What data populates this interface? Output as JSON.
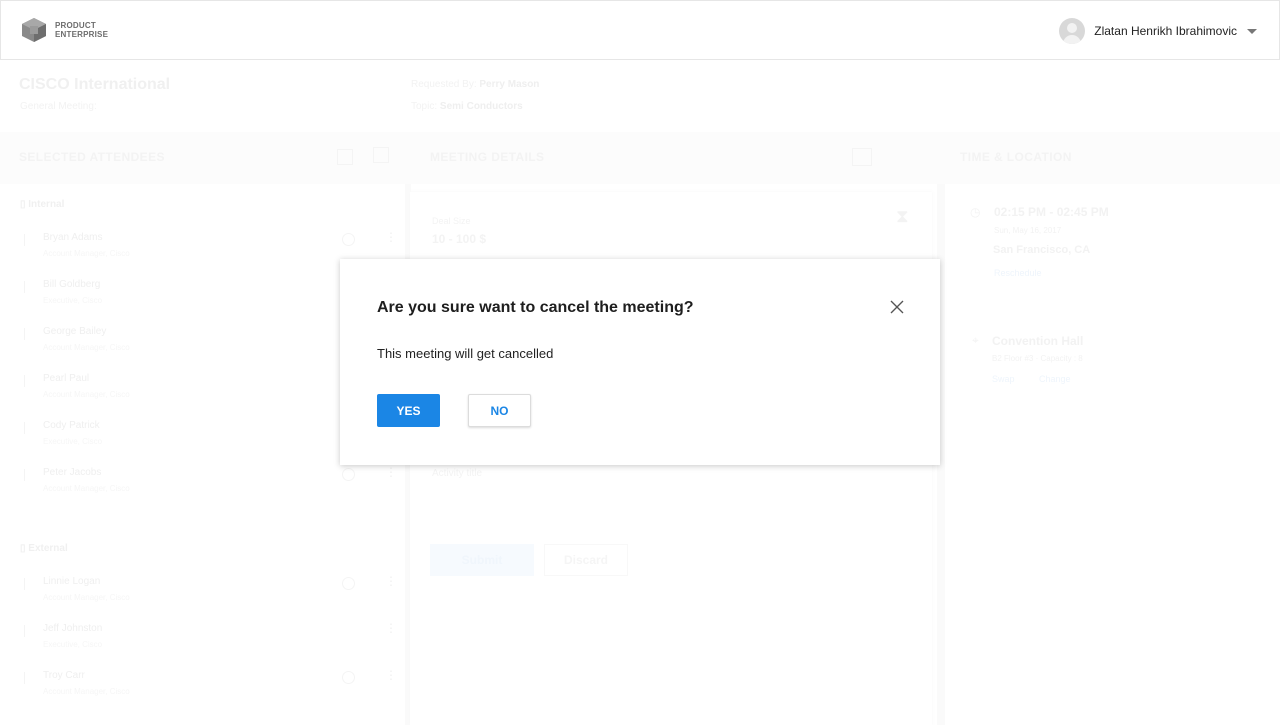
{
  "header": {
    "brand_line1": "PRODUCT",
    "brand_line2": "ENTERPRISE",
    "user_name": "Zlatan Henrikh Ibrahimovic"
  },
  "context": {
    "company": "CISCO International",
    "meeting_type": "General Meeting",
    "requested_by_label": "Requested By",
    "requested_by_value": "Perry Mason",
    "topic_label": "Topic",
    "topic_value": "Semi Conductors"
  },
  "sections": {
    "attendees_title": "SELECTED ATTENDEES",
    "details_title": "MEETING DETAILS",
    "time_location_title": "TIME & LOCATION"
  },
  "attendees": {
    "internal_label": "Internal",
    "internal": [
      {
        "name": "Bryan Adams",
        "role": "Account Manager, Cisco"
      },
      {
        "name": "Bill Goldberg",
        "role": "Executive, Cisco"
      },
      {
        "name": "George Bailey",
        "role": "Account Manager, Cisco"
      },
      {
        "name": "Pearl Paul",
        "role": "Account Manager, Cisco"
      },
      {
        "name": "Cody Patrick",
        "role": "Executive, Cisco"
      },
      {
        "name": "Peter Jacobs",
        "role": "Account Manager, Cisco"
      }
    ],
    "external_label": "External",
    "external": [
      {
        "name": "Linnie Logan",
        "role": "Account Manager, Cisco"
      },
      {
        "name": "Jeff Johnston",
        "role": "Executive, Cisco"
      },
      {
        "name": "Troy Carr",
        "role": "Account Manager, Cisco"
      }
    ]
  },
  "details": {
    "deal_size_label": "Deal Size",
    "deal_size_value": "10 - 100 $",
    "activity_title_label": "Activity title",
    "submit_label": "Submit",
    "discard_label": "Discard"
  },
  "time_location": {
    "time": "02:15 PM - 02:45 PM",
    "date": "Sun, May 16, 2017",
    "city": "San Francisco, CA",
    "reschedule": "Reschedule",
    "venue": "Convention Hall",
    "venue_detail": "B2 Floor #3 · Capacity : 8",
    "swap": "Swap",
    "change": "Change"
  },
  "modal": {
    "title": "Are you sure want to cancel the meeting?",
    "message": "This meeting will get cancelled",
    "yes_label": "YES",
    "no_label": "NO"
  },
  "colors": {
    "primary": "#1b86e5",
    "text": "#1e1e1e"
  }
}
